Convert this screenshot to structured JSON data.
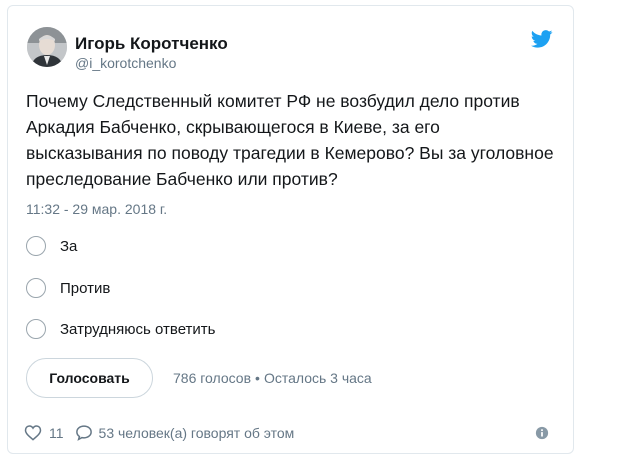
{
  "tweet": {
    "author_name": "Игорь Коротченко",
    "author_handle": "@i_korotchenko",
    "text": "Почему Следственный комитет РФ не возбудил дело против Аркадия Бабченко, скрывающегося в Киеве, за его высказывания по поводу трагедии в Кемерово? Вы за уголовное преследование Бабченко или против?",
    "timestamp": "11:32 - 29 мар. 2018 г."
  },
  "poll": {
    "options": [
      {
        "label": "За"
      },
      {
        "label": "Против"
      },
      {
        "label": "Затрудняюсь ответить"
      }
    ],
    "vote_button_label": "Голосовать",
    "votes": "786 голосов",
    "separator": "•",
    "time_left": "Осталось 3 часа"
  },
  "footer": {
    "likes": "11",
    "talking": "53 человек(а) говорят об этом"
  },
  "colors": {
    "twitter_blue": "#1da1f2",
    "muted_text": "#657786",
    "border": "#e1e8ed"
  },
  "icons": {
    "brand": "twitter-bird-icon",
    "like": "heart-icon",
    "reply": "speech-bubble-icon",
    "info": "info-icon"
  }
}
